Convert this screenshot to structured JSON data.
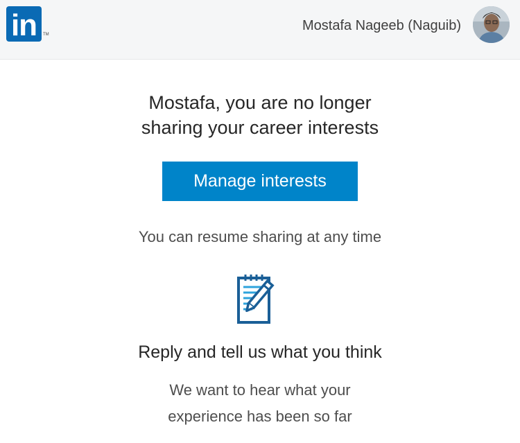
{
  "header": {
    "logo_text": "in",
    "logo_trademark": "TM",
    "user_name": "Mostafa Nageeb (Naguib)"
  },
  "main": {
    "headline_line1": "Mostafa, you are no longer",
    "headline_line2": "sharing your career interests",
    "cta_label": "Manage interests",
    "resume_text": "You can resume sharing at any time",
    "reply_title": "Reply and tell us what you think",
    "reply_body_line1": "We want to hear what your",
    "reply_body_line2": "experience has been so far"
  },
  "colors": {
    "brand_blue": "#0a6ab4",
    "cta_blue": "#0084c9",
    "header_bg": "#f5f6f7"
  },
  "icons": {
    "logo": "linkedin-logo-icon",
    "avatar": "user-avatar",
    "note": "notepad-pencil-icon"
  }
}
